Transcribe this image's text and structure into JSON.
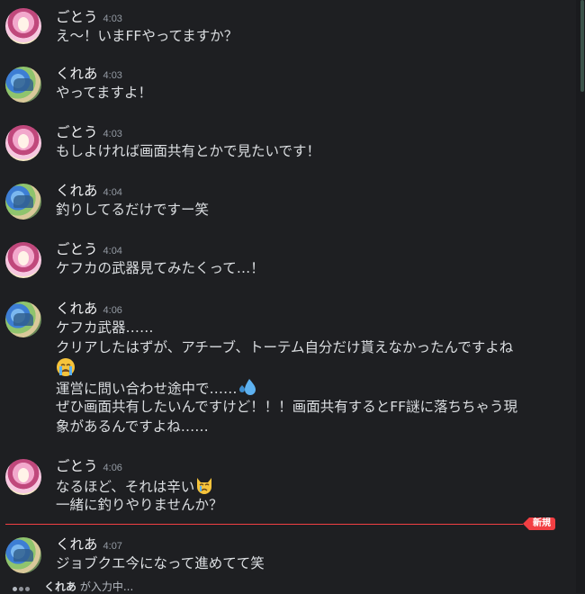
{
  "messages": [
    {
      "author": "ごとう",
      "time": "4:03",
      "lines": [
        "え～！いまFFやってますか？"
      ]
    },
    {
      "author": "くれあ",
      "time": "4:03",
      "lines": [
        "やってますよ！"
      ]
    },
    {
      "author": "ごとう",
      "time": "4:03",
      "lines": [
        "もしよければ画面共有とかで見たいです！"
      ]
    },
    {
      "author": "くれあ",
      "time": "4:04",
      "lines": [
        "釣りしてるだけですー笑"
      ]
    },
    {
      "author": "ごとう",
      "time": "4:04",
      "lines": [
        "ケフカの武器見てみたくって…！"
      ]
    },
    {
      "author": "くれあ",
      "time": "4:06",
      "lines": [
        "ケフカ武器……",
        "クリアしたはずが、アチーブ、トーテム自分だけ貰えなかったんですよね",
        "運営に問い合わせ途中で……",
        "ぜひ画面共有したいんですけど！！！画面共有するとFF謎に落ちちゃう現",
        "象があるんですよね……"
      ],
      "emojis": [
        "crying-face",
        "sweat-droplets"
      ]
    },
    {
      "author": "ごとう",
      "time": "4:06",
      "lines": [
        "なるほど、それは辛い",
        "一緒に釣りやりませんか？"
      ],
      "emojis": [
        "crying-cat"
      ]
    },
    {
      "author": "くれあ",
      "time": "4:07",
      "lines": [
        "ジョブクエ今になって進めてて笑"
      ]
    }
  ],
  "new_divider": {
    "label": "新規",
    "color": "#f23f43"
  },
  "typing": {
    "user": "くれあ",
    "suffix": " が入力中..."
  },
  "colors": {
    "background": "#1e1f22",
    "text": "#dbdee1",
    "timestamp": "#949ba4"
  }
}
